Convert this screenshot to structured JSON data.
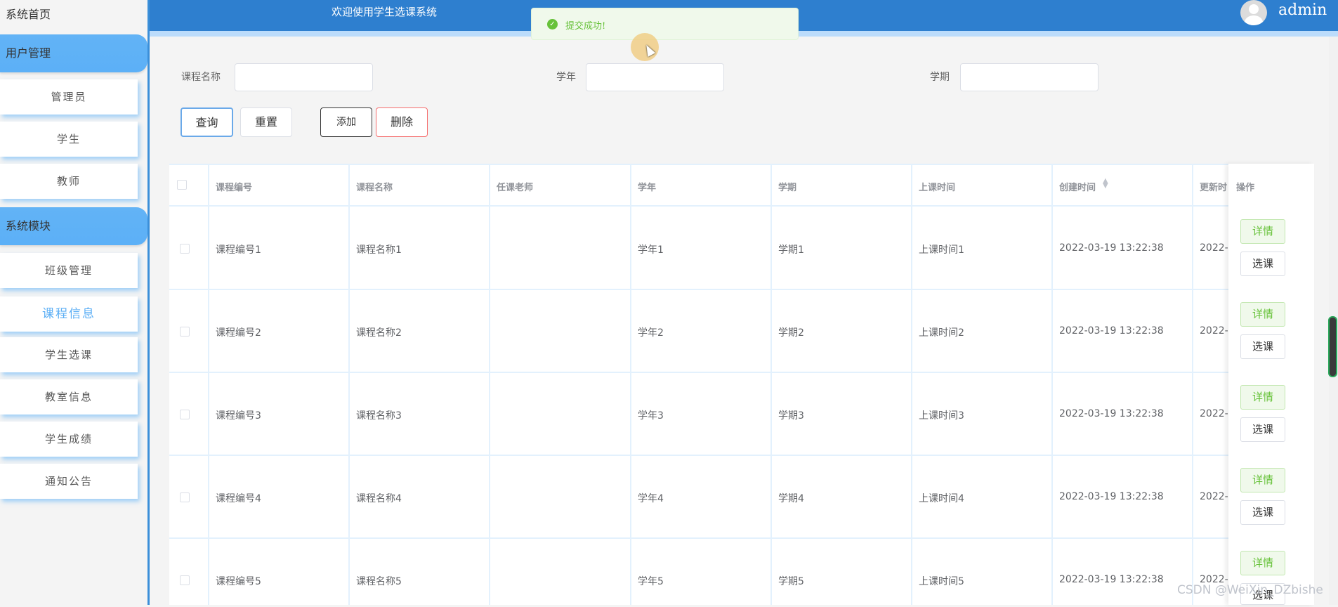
{
  "sidebar": {
    "home": "系统首页",
    "groups": [
      {
        "label": "用户管理"
      },
      {
        "label": "系统模块"
      }
    ],
    "items": [
      {
        "label": "管理员"
      },
      {
        "label": "学生"
      },
      {
        "label": "教师"
      },
      {
        "label": "班级管理"
      },
      {
        "label": "课程信息"
      },
      {
        "label": "学生选课"
      },
      {
        "label": "教室信息"
      },
      {
        "label": "学生成绩"
      },
      {
        "label": "通知公告"
      }
    ]
  },
  "header": {
    "title": "欢迎使用学生选课系统",
    "user": "admin"
  },
  "toast": {
    "icon": "check-circle-icon",
    "message": "提交成功!"
  },
  "search": {
    "course_name_label": "课程名称",
    "year_label": "学年",
    "term_label": "学期",
    "course_name_value": "",
    "year_value": "",
    "term_value": ""
  },
  "buttons": {
    "query": "查询",
    "reset": "重置",
    "add": "添加",
    "delete": "删除"
  },
  "table": {
    "columns": [
      "课程编号",
      "课程名称",
      "任课老师",
      "学年",
      "学期",
      "上课时间",
      "创建时间",
      "更新时",
      "操作"
    ],
    "sort_icon": "sort-caret-icon",
    "rows": [
      {
        "code": "课程编号1",
        "name": "课程名称1",
        "teacher": "",
        "year": "学年1",
        "term": "学期1",
        "time": "上课时间1",
        "created": "2022-03-19 13:22:38",
        "updated": "2022-"
      },
      {
        "code": "课程编号2",
        "name": "课程名称2",
        "teacher": "",
        "year": "学年2",
        "term": "学期2",
        "time": "上课时间2",
        "created": "2022-03-19 13:22:38",
        "updated": "2022-"
      },
      {
        "code": "课程编号3",
        "name": "课程名称3",
        "teacher": "",
        "year": "学年3",
        "term": "学期3",
        "time": "上课时间3",
        "created": "2022-03-19 13:22:38",
        "updated": "2022-"
      },
      {
        "code": "课程编号4",
        "name": "课程名称4",
        "teacher": "",
        "year": "学年4",
        "term": "学期4",
        "time": "上课时间4",
        "created": "2022-03-19 13:22:38",
        "updated": "2022-"
      },
      {
        "code": "课程编号5",
        "name": "课程名称5",
        "teacher": "",
        "year": "学年5",
        "term": "学期5",
        "time": "上课时间5",
        "created": "2022-03-19 13:22:38",
        "updated": "2022-"
      }
    ],
    "actions": {
      "detail": "详情",
      "select": "选课"
    }
  },
  "watermark": "CSDN @WeiXin_DZbishe",
  "colors": {
    "header": "#2e7fcf",
    "sidebar_group": "#5cb0f7",
    "success": "#67c23a",
    "danger": "#f56c6c",
    "primary": "#409eff"
  }
}
